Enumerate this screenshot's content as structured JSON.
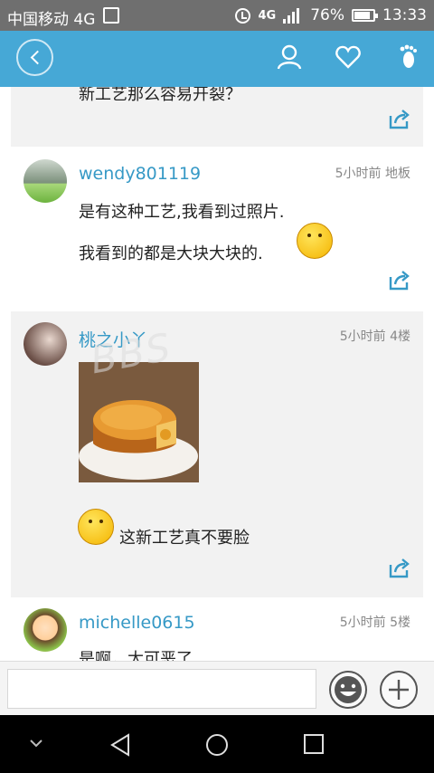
{
  "status_bar": {
    "carrier": "中国移动 4G",
    "network_small": "4G",
    "network_small2": "4G",
    "battery_percent": "76%",
    "time": "13:33"
  },
  "header": {
    "icons": [
      "back-icon",
      "user-icon",
      "heart-icon",
      "foot-icon"
    ],
    "accent_color": "#46a8d6"
  },
  "posts": [
    {
      "text": "新工艺那么容易开裂？"
    },
    {
      "username": "wendy801119",
      "meta": "5小时前 地板",
      "lines": [
        "是有这种工艺,我看到过照片.",
        "我看到的都是大块大块的."
      ]
    },
    {
      "username": "桃之小丫",
      "meta": "5小时前 4楼",
      "text": "这新工艺真不要脸"
    },
    {
      "username": "michelle0615",
      "meta": "5小时前 5楼",
      "text": "是啊，太可恶了"
    }
  ],
  "watermark": "BBS",
  "input": {
    "placeholder": ""
  }
}
